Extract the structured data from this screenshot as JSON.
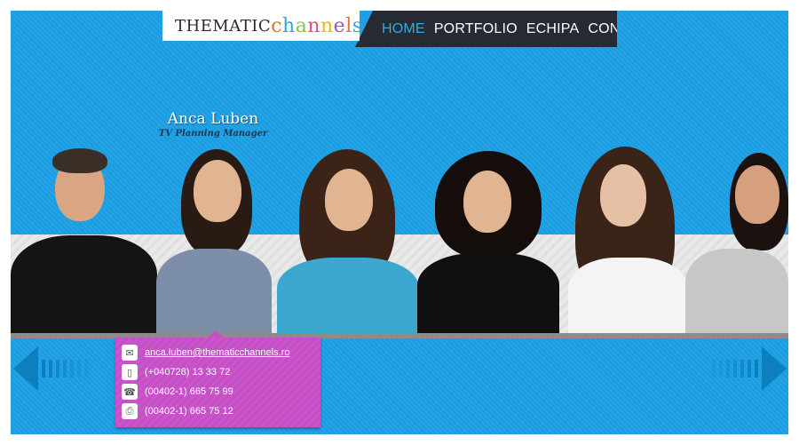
{
  "logo": {
    "part1": "THEMATIC",
    "part2_letters": [
      "c",
      "h",
      "a",
      "n",
      "n",
      "e",
      "l",
      "s"
    ],
    "part2_colors": [
      "#e8702a",
      "#2aa7e0",
      "#8bc53f",
      "#e94c7a",
      "#f4b400",
      "#9b59b6",
      "#e8702a",
      "#2aa7e0"
    ]
  },
  "nav": {
    "items": [
      {
        "label": "HOME",
        "active": true
      },
      {
        "label": "PORTFOLIO",
        "active": false
      },
      {
        "label": "ECHIPA",
        "active": false
      },
      {
        "label": "CONTACT",
        "active": false
      }
    ]
  },
  "profile": {
    "name": "Anca Luben",
    "title": "TV Planning Manager"
  },
  "contact": {
    "email": "anca.luben@thematicchannels.ro",
    "mobile": "(+040728) 13 33 72",
    "phone": "(00402-1) 665 75 99",
    "fax": "(00402-1) 665 75 12"
  },
  "icons": {
    "email": "envelope-icon",
    "mobile": "mobile-phone-icon",
    "phone": "telephone-icon",
    "fax": "fax-icon",
    "prev": "arrow-left-icon",
    "next": "arrow-right-icon"
  },
  "colors": {
    "background": "#1da1e6",
    "nav_bg": "#262a33",
    "nav_active": "#2aaee9",
    "contact_bg": "#c64fc8"
  }
}
